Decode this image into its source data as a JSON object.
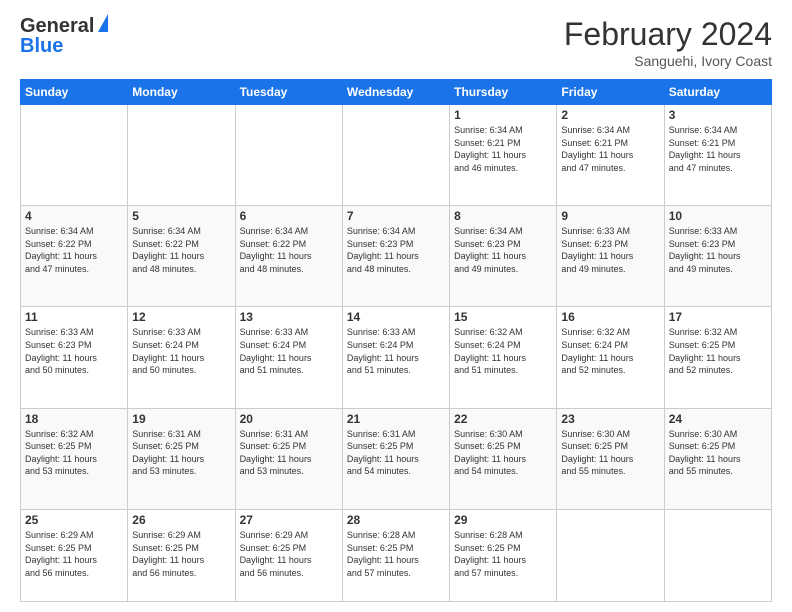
{
  "header": {
    "logo": {
      "general": "General",
      "blue": "Blue"
    },
    "title": "February 2024",
    "location": "Sanguehi, Ivory Coast"
  },
  "days_of_week": [
    "Sunday",
    "Monday",
    "Tuesday",
    "Wednesday",
    "Thursday",
    "Friday",
    "Saturday"
  ],
  "weeks": [
    [
      {
        "day": "",
        "info": ""
      },
      {
        "day": "",
        "info": ""
      },
      {
        "day": "",
        "info": ""
      },
      {
        "day": "",
        "info": ""
      },
      {
        "day": "1",
        "info": "Sunrise: 6:34 AM\nSunset: 6:21 PM\nDaylight: 11 hours\nand 46 minutes."
      },
      {
        "day": "2",
        "info": "Sunrise: 6:34 AM\nSunset: 6:21 PM\nDaylight: 11 hours\nand 47 minutes."
      },
      {
        "day": "3",
        "info": "Sunrise: 6:34 AM\nSunset: 6:21 PM\nDaylight: 11 hours\nand 47 minutes."
      }
    ],
    [
      {
        "day": "4",
        "info": "Sunrise: 6:34 AM\nSunset: 6:22 PM\nDaylight: 11 hours\nand 47 minutes."
      },
      {
        "day": "5",
        "info": "Sunrise: 6:34 AM\nSunset: 6:22 PM\nDaylight: 11 hours\nand 48 minutes."
      },
      {
        "day": "6",
        "info": "Sunrise: 6:34 AM\nSunset: 6:22 PM\nDaylight: 11 hours\nand 48 minutes."
      },
      {
        "day": "7",
        "info": "Sunrise: 6:34 AM\nSunset: 6:23 PM\nDaylight: 11 hours\nand 48 minutes."
      },
      {
        "day": "8",
        "info": "Sunrise: 6:34 AM\nSunset: 6:23 PM\nDaylight: 11 hours\nand 49 minutes."
      },
      {
        "day": "9",
        "info": "Sunrise: 6:33 AM\nSunset: 6:23 PM\nDaylight: 11 hours\nand 49 minutes."
      },
      {
        "day": "10",
        "info": "Sunrise: 6:33 AM\nSunset: 6:23 PM\nDaylight: 11 hours\nand 49 minutes."
      }
    ],
    [
      {
        "day": "11",
        "info": "Sunrise: 6:33 AM\nSunset: 6:23 PM\nDaylight: 11 hours\nand 50 minutes."
      },
      {
        "day": "12",
        "info": "Sunrise: 6:33 AM\nSunset: 6:24 PM\nDaylight: 11 hours\nand 50 minutes."
      },
      {
        "day": "13",
        "info": "Sunrise: 6:33 AM\nSunset: 6:24 PM\nDaylight: 11 hours\nand 51 minutes."
      },
      {
        "day": "14",
        "info": "Sunrise: 6:33 AM\nSunset: 6:24 PM\nDaylight: 11 hours\nand 51 minutes."
      },
      {
        "day": "15",
        "info": "Sunrise: 6:32 AM\nSunset: 6:24 PM\nDaylight: 11 hours\nand 51 minutes."
      },
      {
        "day": "16",
        "info": "Sunrise: 6:32 AM\nSunset: 6:24 PM\nDaylight: 11 hours\nand 52 minutes."
      },
      {
        "day": "17",
        "info": "Sunrise: 6:32 AM\nSunset: 6:25 PM\nDaylight: 11 hours\nand 52 minutes."
      }
    ],
    [
      {
        "day": "18",
        "info": "Sunrise: 6:32 AM\nSunset: 6:25 PM\nDaylight: 11 hours\nand 53 minutes."
      },
      {
        "day": "19",
        "info": "Sunrise: 6:31 AM\nSunset: 6:25 PM\nDaylight: 11 hours\nand 53 minutes."
      },
      {
        "day": "20",
        "info": "Sunrise: 6:31 AM\nSunset: 6:25 PM\nDaylight: 11 hours\nand 53 minutes."
      },
      {
        "day": "21",
        "info": "Sunrise: 6:31 AM\nSunset: 6:25 PM\nDaylight: 11 hours\nand 54 minutes."
      },
      {
        "day": "22",
        "info": "Sunrise: 6:30 AM\nSunset: 6:25 PM\nDaylight: 11 hours\nand 54 minutes."
      },
      {
        "day": "23",
        "info": "Sunrise: 6:30 AM\nSunset: 6:25 PM\nDaylight: 11 hours\nand 55 minutes."
      },
      {
        "day": "24",
        "info": "Sunrise: 6:30 AM\nSunset: 6:25 PM\nDaylight: 11 hours\nand 55 minutes."
      }
    ],
    [
      {
        "day": "25",
        "info": "Sunrise: 6:29 AM\nSunset: 6:25 PM\nDaylight: 11 hours\nand 56 minutes."
      },
      {
        "day": "26",
        "info": "Sunrise: 6:29 AM\nSunset: 6:25 PM\nDaylight: 11 hours\nand 56 minutes."
      },
      {
        "day": "27",
        "info": "Sunrise: 6:29 AM\nSunset: 6:25 PM\nDaylight: 11 hours\nand 56 minutes."
      },
      {
        "day": "28",
        "info": "Sunrise: 6:28 AM\nSunset: 6:25 PM\nDaylight: 11 hours\nand 57 minutes."
      },
      {
        "day": "29",
        "info": "Sunrise: 6:28 AM\nSunset: 6:25 PM\nDaylight: 11 hours\nand 57 minutes."
      },
      {
        "day": "",
        "info": ""
      },
      {
        "day": "",
        "info": ""
      }
    ]
  ]
}
